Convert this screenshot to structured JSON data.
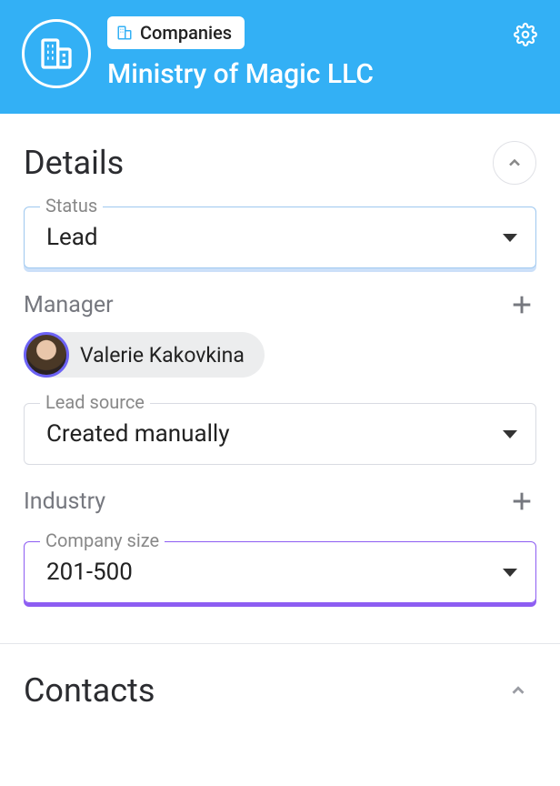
{
  "header": {
    "breadcrumb_label": "Companies",
    "title": "Ministry of Magic LLC"
  },
  "details": {
    "section_title": "Details",
    "status_label": "Status",
    "status_value": "Lead",
    "manager_label": "Manager",
    "manager_name": "Valerie Kakovkina",
    "lead_source_label": "Lead source",
    "lead_source_value": "Created manually",
    "industry_label": "Industry",
    "company_size_label": "Company size",
    "company_size_value": "201-500"
  },
  "contacts": {
    "section_title": "Contacts"
  }
}
